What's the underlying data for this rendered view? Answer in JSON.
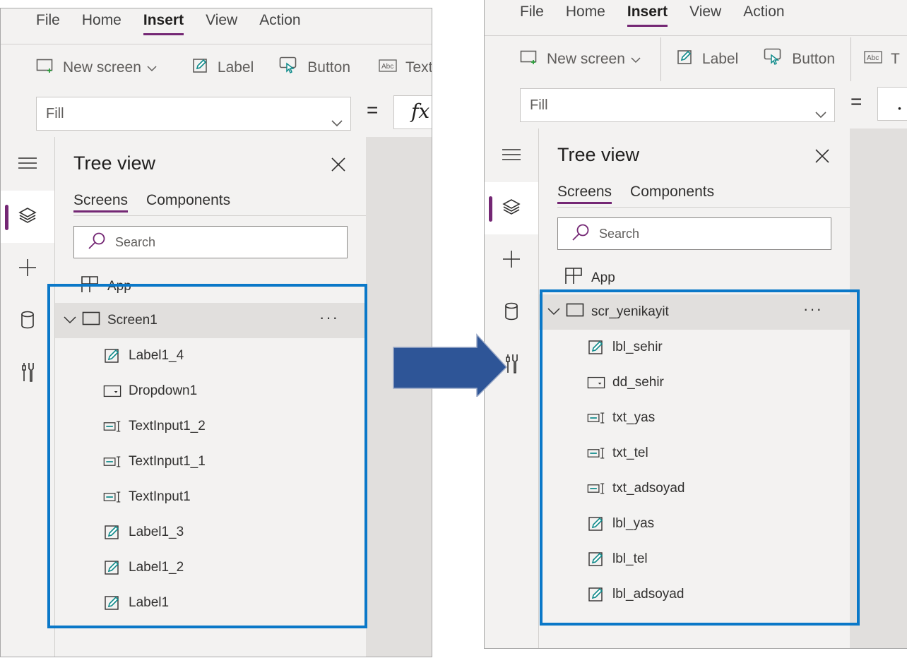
{
  "menu": [
    "File",
    "Home",
    "Insert",
    "View",
    "Action"
  ],
  "menu_active": "Insert",
  "toolbar": {
    "new_screen": "New screen",
    "label": "Label",
    "button": "Button",
    "text": "Text",
    "text_left": "Text",
    "text_right": "T"
  },
  "formula": {
    "property": "Fill",
    "equals": "=",
    "fx_left": "fx",
    "fx_right": "."
  },
  "tree": {
    "title": "Tree view",
    "tab_screens": "Screens",
    "tab_components": "Components",
    "search_placeholder": "Search",
    "app_label": "App"
  },
  "before": {
    "screen": "Screen1",
    "controls": [
      {
        "type": "label",
        "name": "Label1_4"
      },
      {
        "type": "dropdown",
        "name": "Dropdown1"
      },
      {
        "type": "textinput",
        "name": "TextInput1_2"
      },
      {
        "type": "textinput",
        "name": "TextInput1_1"
      },
      {
        "type": "textinput",
        "name": "TextInput1"
      },
      {
        "type": "label",
        "name": "Label1_3"
      },
      {
        "type": "label",
        "name": "Label1_2"
      },
      {
        "type": "label",
        "name": "Label1"
      }
    ]
  },
  "after": {
    "screen": "scr_yenikayit",
    "controls": [
      {
        "type": "label",
        "name": "lbl_sehir"
      },
      {
        "type": "dropdown",
        "name": "dd_sehir"
      },
      {
        "type": "textinput",
        "name": "txt_yas"
      },
      {
        "type": "textinput",
        "name": "txt_tel"
      },
      {
        "type": "textinput",
        "name": "txt_adsoyad"
      },
      {
        "type": "label",
        "name": "lbl_yas"
      },
      {
        "type": "label",
        "name": "lbl_tel"
      },
      {
        "type": "label",
        "name": "lbl_adsoyad"
      }
    ]
  },
  "more_glyph": "···",
  "colors": {
    "accent": "#742774",
    "highlight": "#0a78c8",
    "arrow": "#2e5597",
    "control_icon": "#0e8a8a"
  }
}
